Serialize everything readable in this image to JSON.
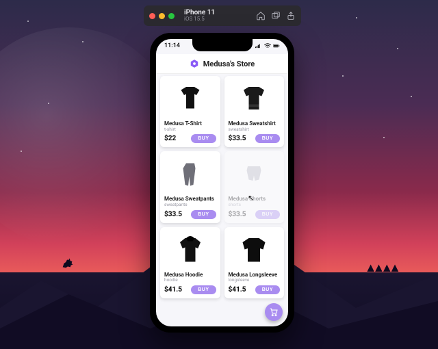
{
  "simulator": {
    "device": "iPhone 11",
    "os": "iOS 15.5"
  },
  "statusbar": {
    "time": "11:14"
  },
  "header": {
    "store_name": "Medusa's Store"
  },
  "products": [
    {
      "name": "Medusa T-Shirt",
      "category": "t-shirt",
      "price": "$22",
      "buy": "BUY"
    },
    {
      "name": "Medusa Sweatshirt",
      "category": "sweatshirt",
      "price": "$33.5",
      "buy": "BUY"
    },
    {
      "name": "Medusa Sweatpants",
      "category": "sweatpants",
      "price": "$33.5",
      "buy": "BUY"
    },
    {
      "name": "Medusa Shorts",
      "category": "shorts",
      "price": "$33.5",
      "buy": "BUY"
    },
    {
      "name": "Medusa Hoodie",
      "category": "hoodie",
      "price": "$41.5",
      "buy": "BUY"
    },
    {
      "name": "Medusa Longsleeve",
      "category": "longsleeve",
      "price": "$41.5",
      "buy": "BUY"
    }
  ],
  "colors": {
    "accent": "#a98cf0"
  }
}
